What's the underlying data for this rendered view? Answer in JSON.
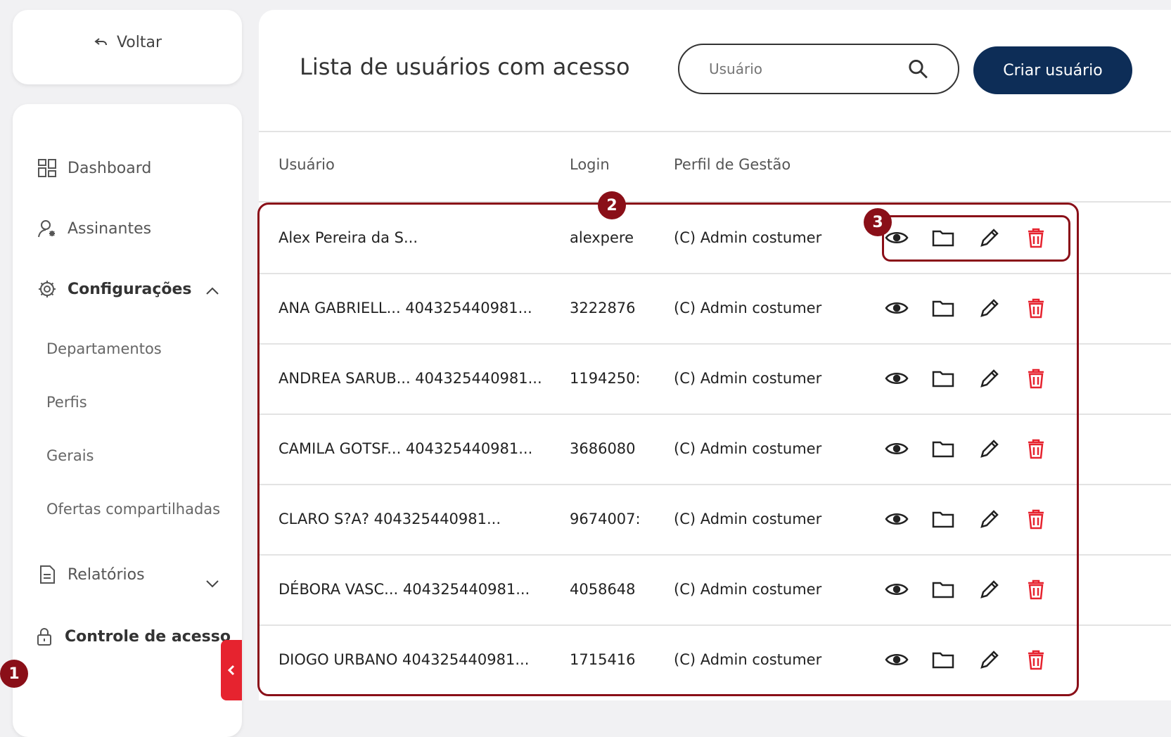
{
  "sidebar": {
    "back_label": "Voltar",
    "items": [
      {
        "label": "Dashboard",
        "icon": "dashboard-icon"
      },
      {
        "label": "Assinantes",
        "icon": "subscribers-icon"
      },
      {
        "label": "Configurações",
        "icon": "gear-icon"
      },
      {
        "label": "Relatórios",
        "icon": "report-icon"
      },
      {
        "label": "Controle de acesso",
        "icon": "lock-icon"
      }
    ],
    "sub_items": [
      "Departamentos",
      "Perfis",
      "Gerais",
      "Ofertas compartilhadas"
    ]
  },
  "header": {
    "title": "Lista de usuários com acesso",
    "search_placeholder": "Usuário",
    "create_button": "Criar usuário"
  },
  "table": {
    "columns": [
      "Usuário",
      "Login",
      "Perfil de Gestão"
    ],
    "rows": [
      {
        "usuario": "Alex Pereira da S...",
        "login": "alexpere",
        "perfil": "(C) Admin costumer"
      },
      {
        "usuario": "ANA GABRIELL... 404325440981...",
        "login": "3222876",
        "perfil": "(C) Admin costumer"
      },
      {
        "usuario": "ANDREA SARUB... 404325440981...",
        "login": "1194250:",
        "perfil": "(C) Admin costumer"
      },
      {
        "usuario": "CAMILA GOTSF... 404325440981...",
        "login": "3686080",
        "perfil": "(C) Admin costumer"
      },
      {
        "usuario": "CLARO S?A? 404325440981...",
        "login": "9674007:",
        "perfil": "(C) Admin costumer"
      },
      {
        "usuario": "DÉBORA VASC... 404325440981...",
        "login": "4058648",
        "perfil": "(C) Admin costumer"
      },
      {
        "usuario": "DIOGO URBANO 404325440981...",
        "login": "1715416",
        "perfil": "(C) Admin costumer"
      }
    ]
  },
  "callouts": [
    "1",
    "2",
    "3"
  ],
  "colors": {
    "primary": "#0d2d57",
    "danger": "#e6232f",
    "callout": "#8a0f18"
  }
}
